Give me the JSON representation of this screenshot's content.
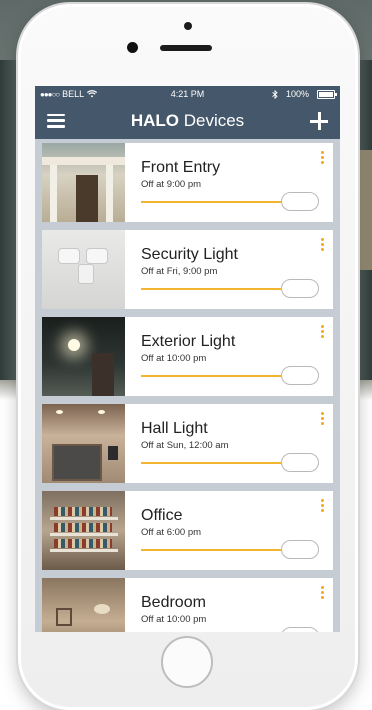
{
  "status_bar": {
    "carrier": "BELL",
    "time": "4:21 PM",
    "battery": "100%"
  },
  "nav": {
    "title_bold": "HALO",
    "title_rest": " Devices"
  },
  "icons": {
    "menu": "hamburger-icon",
    "add": "plus-icon",
    "more": "kebab-icon",
    "wifi": "wifi-icon",
    "bluetooth": "bluetooth-icon"
  },
  "colors": {
    "nav_bg": "#45576a",
    "accent": "#f2b52d",
    "list_bg": "#c5ccd3"
  },
  "devices": [
    {
      "name": "Front Entry",
      "status": "Off at 9:00 pm"
    },
    {
      "name": "Security Light",
      "status": "Off at Fri, 9:00 pm"
    },
    {
      "name": "Exterior Light",
      "status": "Off at 10:00 pm"
    },
    {
      "name": "Hall Light",
      "status": "Off at Sun, 12:00 am"
    },
    {
      "name": "Office",
      "status": "Off at 6:00 pm"
    },
    {
      "name": "Bedroom",
      "status": "Off at 10:00 pm"
    }
  ]
}
